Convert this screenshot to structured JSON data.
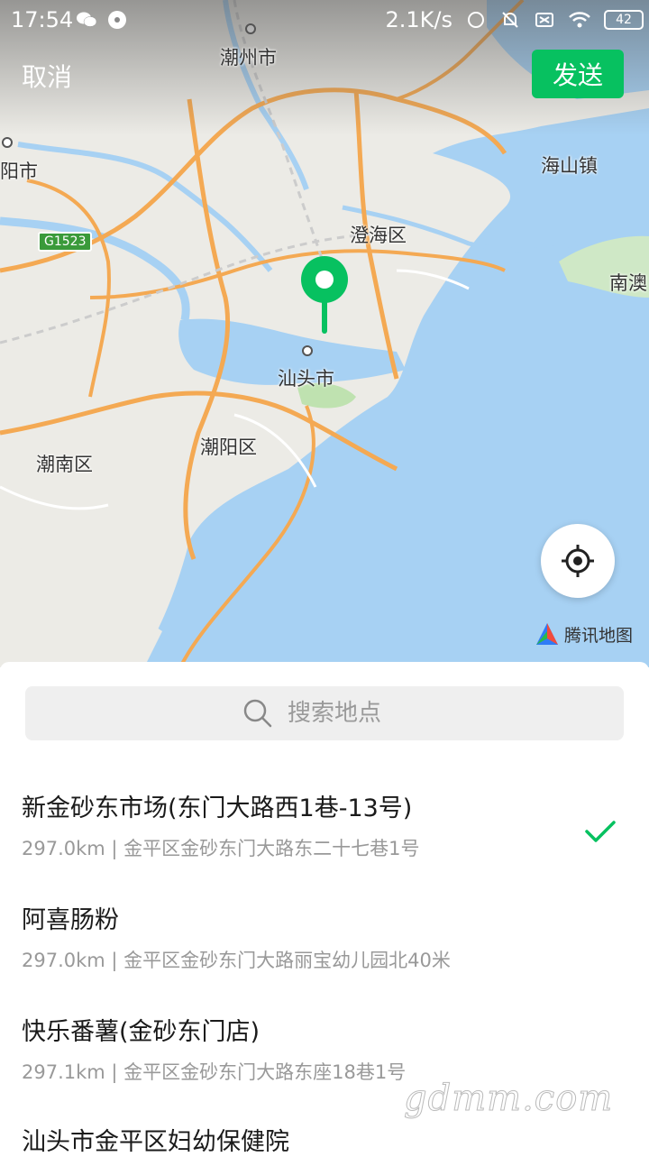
{
  "status_bar": {
    "time": "17:54",
    "net_speed": "2.1K/s",
    "battery": "42"
  },
  "header": {
    "cancel_label": "取消",
    "send_label": "发送"
  },
  "map": {
    "labels": {
      "chaozhou": "潮州市",
      "jieyang": "阳市",
      "haishan": "海山镇",
      "chenghai": "澄海区",
      "nanao": "南澳",
      "shantou": "汕头市",
      "chaonan": "潮南区",
      "chaoyang": "潮阳区"
    },
    "highway_badge": "G1523",
    "attribution": "腾讯地图"
  },
  "search": {
    "placeholder": "搜索地点"
  },
  "poi_list": [
    {
      "name": "新金砂东市场(东门大路西1巷-13号)",
      "address": "297.0km | 金平区金砂东门大路东二十七巷1号",
      "selected": true
    },
    {
      "name": "阿喜肠粉",
      "address": "297.0km | 金平区金砂东门大路丽宝幼儿园北40米",
      "selected": false
    },
    {
      "name": "快乐番薯(金砂东门店)",
      "address": "297.1km | 金平区金砂东门大路东座18巷1号",
      "selected": false
    },
    {
      "name": "汕头市金平区妇幼保健院",
      "address": "",
      "selected": false
    }
  ],
  "watermark": "gdmm.com",
  "colors": {
    "accent": "#07c160",
    "water": "#a7d1f3",
    "road": "#f4a953"
  }
}
